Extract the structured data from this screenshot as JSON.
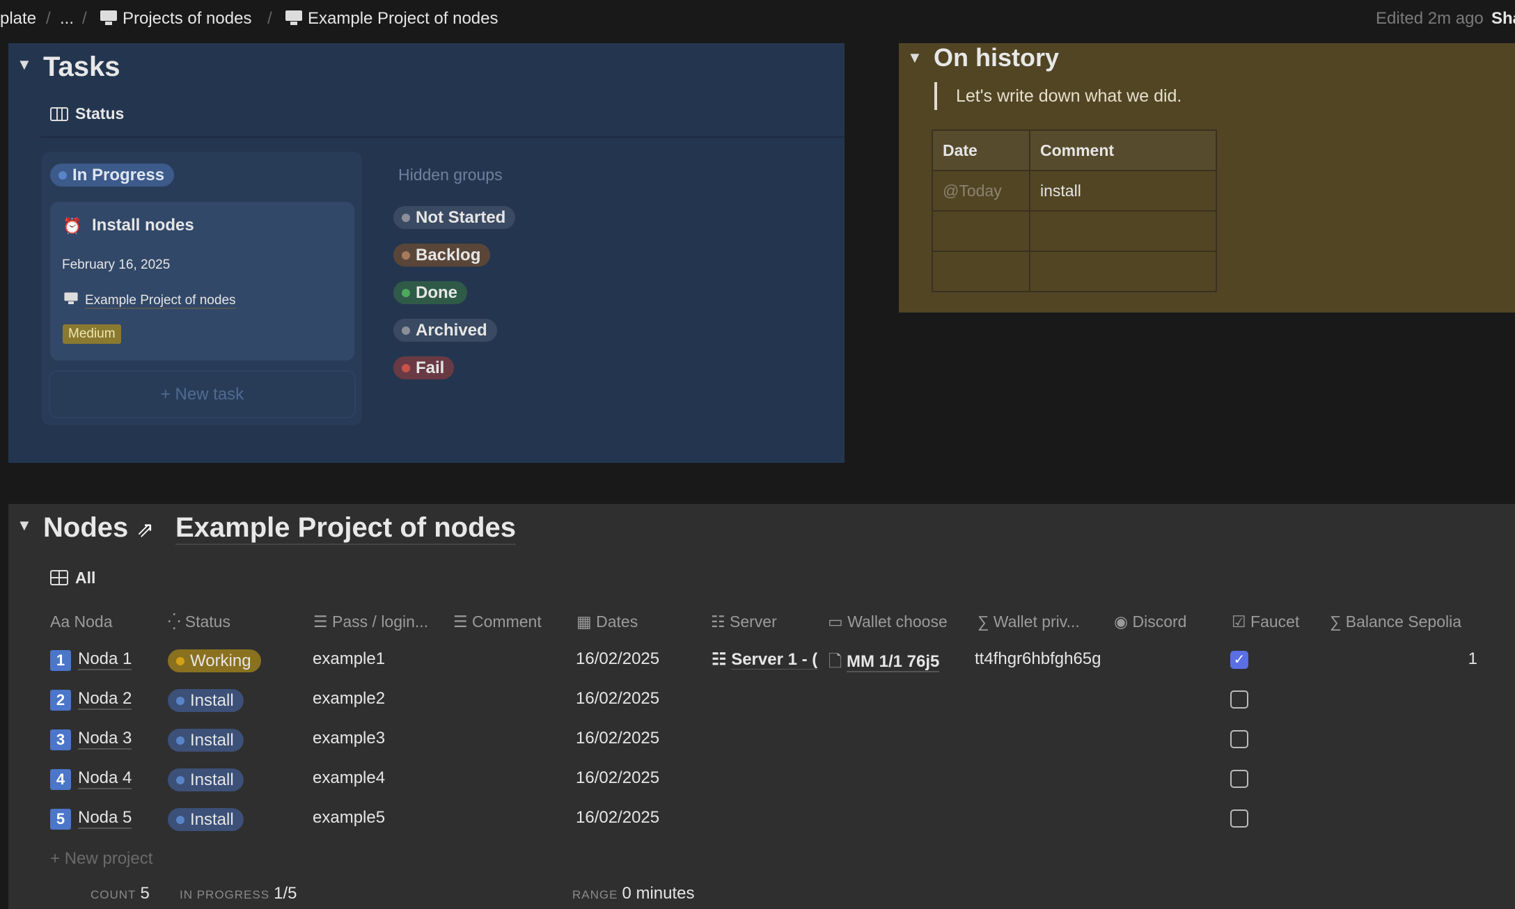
{
  "breadcrumb": {
    "items": [
      "plate",
      "...",
      "Projects of nodes",
      "Example Project of nodes"
    ],
    "edited": "Edited 2m ago",
    "share": "Sha"
  },
  "tasks": {
    "title": "Tasks",
    "view": "Status",
    "group": "In Progress",
    "card": {
      "title": "Install nodes",
      "date": "February 16, 2025",
      "project": "Example Project of nodes",
      "priority": "Medium"
    },
    "new_task": "New task",
    "hidden_label": "Hidden groups",
    "hidden_groups": [
      {
        "label": "Not Started",
        "color": "#8a8f98"
      },
      {
        "label": "Backlog",
        "color": "#a87a5c"
      },
      {
        "label": "Done",
        "color": "#4fa85f"
      },
      {
        "label": "Archived",
        "color": "#8a8f98"
      },
      {
        "label": "Fail",
        "color": "#c8534a"
      }
    ]
  },
  "history": {
    "title": "On history",
    "quote": "Let's write down what we did.",
    "headers": [
      "Date",
      "Comment"
    ],
    "rows": [
      [
        "@Today",
        "install"
      ],
      [
        "",
        ""
      ],
      [
        "",
        ""
      ]
    ]
  },
  "nodes": {
    "title": "Nodes",
    "linked": "Example Project of nodes",
    "view": "All",
    "columns": [
      "Noda",
      "Status",
      "Pass / login...",
      "Comment",
      "Dates",
      "Server",
      "Wallet choose",
      "Wallet priv...",
      "Discord",
      "Faucet",
      "Balance Sepolia"
    ],
    "col_prefix": "Aa",
    "rows": [
      {
        "num": "1",
        "name": "Noda 1",
        "status": "Working",
        "pass": "example1",
        "date": "16/02/2025",
        "server": "Server 1 - (",
        "wallet": "MM 1/1 76j5",
        "priv": "tt4fhgr6hbfgh65g",
        "faucet": true,
        "balance": "1"
      },
      {
        "num": "2",
        "name": "Noda 2",
        "status": "Install",
        "pass": "example2",
        "date": "16/02/2025",
        "faucet": false
      },
      {
        "num": "3",
        "name": "Noda 3",
        "status": "Install",
        "pass": "example3",
        "date": "16/02/2025",
        "faucet": false
      },
      {
        "num": "4",
        "name": "Noda 4",
        "status": "Install",
        "pass": "example4",
        "date": "16/02/2025",
        "faucet": false
      },
      {
        "num": "5",
        "name": "Noda 5",
        "status": "Install",
        "pass": "example5",
        "date": "16/02/2025",
        "faucet": false
      }
    ],
    "new_project": "New project",
    "footer": {
      "count_label": "COUNT",
      "count": "5",
      "progress_label": "IN PROGRESS",
      "progress": "1/5",
      "range_label": "RANGE",
      "range": "0 minutes"
    }
  },
  "colors": {
    "working": "#8a7120",
    "install": "#3c5078",
    "accent": "#5a6fe3"
  }
}
